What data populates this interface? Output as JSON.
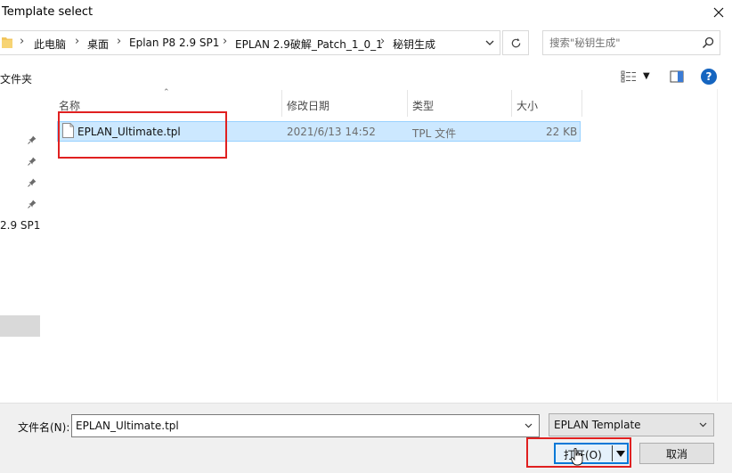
{
  "window": {
    "title": "Template select"
  },
  "address": {
    "crumbs": [
      "此电脑",
      "桌面",
      "Eplan P8 2.9 SP1",
      "EPLAN 2.9破解_Patch_1_0_1",
      "秘钥生成"
    ]
  },
  "search": {
    "placeholder": "搜索\"秘钥生成\""
  },
  "toolbar": {
    "new_folder_label": "文件夹"
  },
  "nav": {
    "partial_label": "2.9 SP1"
  },
  "columns": {
    "name": "名称",
    "modified": "修改日期",
    "type": "类型",
    "size": "大小"
  },
  "files": [
    {
      "name": "EPLAN_Ultimate.tpl",
      "modified": "2021/6/13 14:52",
      "type": "TPL 文件",
      "size": "22 KB"
    }
  ],
  "bottom": {
    "filename_label": "文件名(N):",
    "filename_value": "EPLAN_Ultimate.tpl",
    "filter_value": "EPLAN Template",
    "open_label": "打开(O)",
    "cancel_label": "取消"
  },
  "colors": {
    "selection": "#cce8ff",
    "selection_border": "#99d1ff",
    "annotation_red": "#e02020",
    "accent": "#0078d7"
  },
  "icons": {
    "close": "close-icon",
    "folder": "folder-icon",
    "refresh": "refresh-icon",
    "search": "search-icon",
    "view": "view-options-icon",
    "preview_pane": "preview-pane-icon",
    "help": "help-icon",
    "pin": "pin-icon",
    "file": "file-icon"
  }
}
